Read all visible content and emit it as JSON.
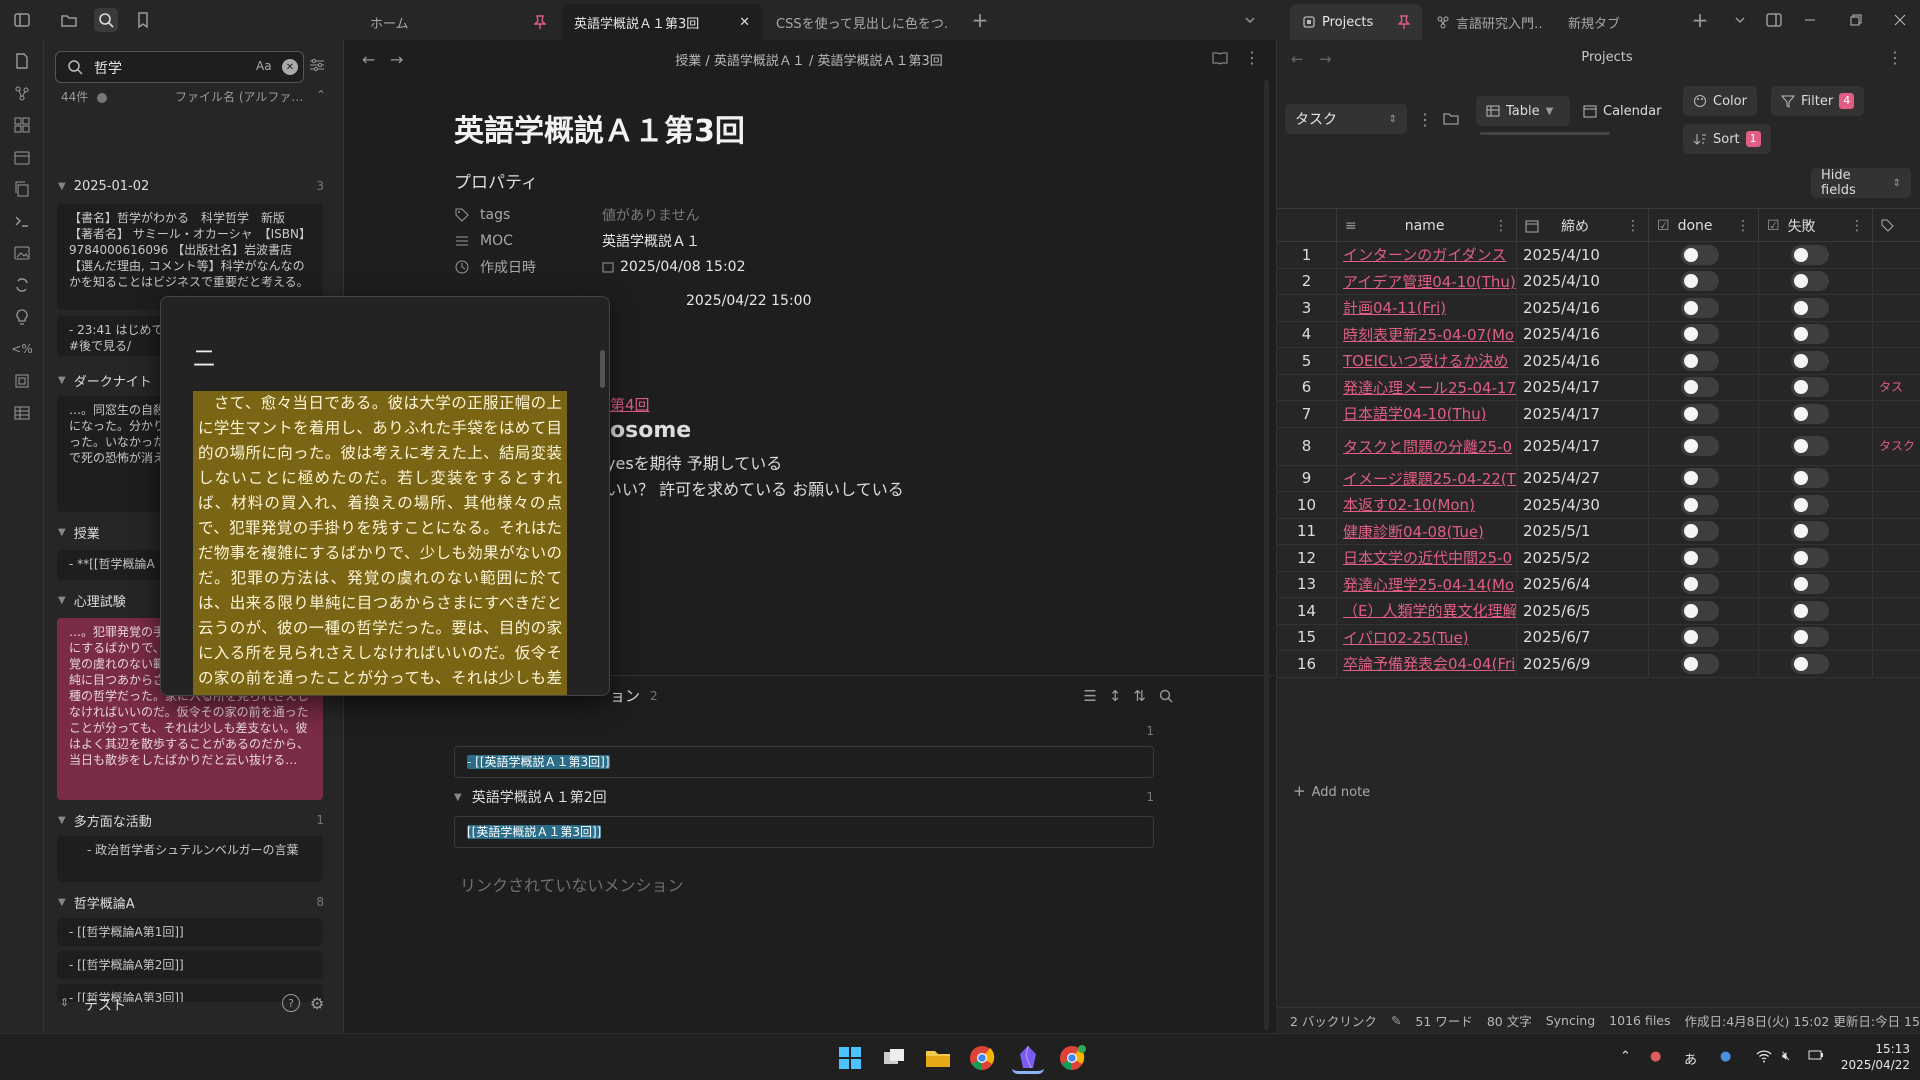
{
  "tabs": [
    {
      "label": "ホーム",
      "pinned": true
    },
    {
      "label": "英語学概説Ａ１第3回",
      "active": true
    },
    {
      "label": "CSSを使って見出しに色をつ…"
    }
  ],
  "right_tabs": [
    {
      "label": "Projects",
      "pinned": true,
      "active": true
    },
    {
      "label": "言語研究入門…"
    },
    {
      "label": "新規タブ"
    }
  ],
  "search": {
    "query": "哲学",
    "match_case": "Aa",
    "count": "44件",
    "sort": "ファイル名 (アルファ…"
  },
  "results": {
    "groups": [
      {
        "title": "2025-01-02",
        "count": "3"
      },
      {
        "title": "ダークナイト",
        "count": ""
      },
      {
        "title": "授業",
        "count": ""
      },
      {
        "title": "心理試験",
        "count": ""
      },
      {
        "title": "多方面な活動",
        "count": "1"
      },
      {
        "title": "哲学概論A",
        "count": "8"
      }
    ],
    "snippets": {
      "r1": "【書名】哲学がわかる　科学哲学　新版　【著者名】 サミール・オカーシャ　【ISBN】9784000616096 【出版社名】岩波書店【選んだ理由, コメント等】科学がなんなのかを知ることはビジネスで重要だと考える。",
      "r2": "- 23:41 はじめての政治哲学　図書館にある　#後で見る/",
      "r3": "…。同窓生の自殺がわかるように考えるようになった。分かり神に救いを求めるようになった。いなかった。ハイ論い合えという哲学で死の恐怖が消え",
      "r4": "- **[[哲学概論A",
      "r5": "…。犯罪発覚の手段をそれはただ物事を複雑にするばかりで、少しも効果がないのだ。発覚の虞れのない範囲に於ては、出来る限り単純に目つあからさまにすべきだ。が、彼の一種の哲学だった。家に入る所を見られさえしなければいいのだ。仮令その家の前を通ったことが分っても、それは少しも差支ない。彼はよく其辺を散歩することがあるのだから、当日も散歩をしたばかりだと云い抜ける…",
      "r6": "- 政治哲学者シュテルンベルガーの言葉",
      "r7": "- [[哲学概論A第1回]]",
      "r8": "- [[哲学概論A第2回]]",
      "r9": "- [[哲学概論A第3回]]"
    },
    "footer": "テスト"
  },
  "editor": {
    "breadcrumb": "授業 / 英語学概説Ａ１ / 英語学概説Ａ１第3回",
    "title": "英語学概説Ａ１第3回",
    "properties_heading": "プロパティ",
    "props": {
      "tags_key": "tags",
      "tags_val": "値がありません",
      "moc_key": "MOC",
      "moc_val": "英語学概説Ａ１",
      "created_key": "作成日時",
      "created_val": "2025/04/08  15:02",
      "updated_val": "2025/04/22  15:00"
    },
    "body": {
      "next_link": "第4回",
      "heading": "osome",
      "line1": "yesを期待 予期している",
      "line2": "いい？ 許可を求めている お願いしている"
    },
    "backlinks": {
      "heading": "ョン",
      "count": "2",
      "g1_count": "1",
      "card1": "- [[英語学概説Ａ１第3回]]",
      "group2": "英語学概説Ａ１第2回",
      "g2_count": "1",
      "card2": "[[英語学概説Ａ１第3回]]"
    },
    "unlinked": "リンクされていないメンション"
  },
  "popover": {
    "heading": "二",
    "text": "　さて、愈々当日である。彼は大学の正服正帽の上に学生マントを着用し、ありふれた手袋をはめて目的の場所に向った。彼は考えに考えた上、結局変装しないことに極めたのだ。若し変装をするとすれば、材料の買入れ、着換えの場所、其他様々の点で、犯罪発覚の手掛りを残すことになる。それはただ物事を複雑にするばかりで、少しも効果がないのだ。犯罪の方法は、発覚の虞れのない範囲に於ては、出来る限り単純に目つあからさまにすべきだと云うのが、彼の一種の哲学だった。要は、目的の家に入る所を見られさえしなければいいのだ。仮令その家の前を通ったことが分っても、それは少しも差支ない。彼はよく其辺を散歩することがあるのだか"
  },
  "projects": {
    "title": "Projects",
    "view_select": "タスク",
    "table_label": "Table",
    "calendar_label": "Calendar",
    "color_label": "Color",
    "filter_label": "Filter",
    "filter_count": "4",
    "sort_label": "Sort",
    "sort_count": "1",
    "hide_fields": "Hide fields",
    "columns": [
      "name",
      "締め",
      "done",
      "失敗"
    ],
    "rows": [
      {
        "n": "1",
        "name": "インターンのガイダンス",
        "date": "2025/4/10",
        "done": false,
        "fail": false,
        "tag": ""
      },
      {
        "n": "2",
        "name": "アイデア管理04-10(Thu)",
        "date": "2025/4/10",
        "done": false,
        "fail": false,
        "tag": ""
      },
      {
        "n": "3",
        "name": "計画04-11(Fri)",
        "date": "2025/4/16",
        "done": false,
        "fail": false,
        "tag": ""
      },
      {
        "n": "4",
        "name": "時刻表更新25-04-07(Mo",
        "date": "2025/4/16",
        "done": false,
        "fail": false,
        "tag": ""
      },
      {
        "n": "5",
        "name": "TOEICいつ受けるか決め",
        "date": "2025/4/16",
        "done": false,
        "fail": false,
        "tag": ""
      },
      {
        "n": "6",
        "name": "発達心理メール25-04-17",
        "date": "2025/4/17",
        "done": false,
        "fail": false,
        "tag": "タス"
      },
      {
        "n": "7",
        "name": "日本語学04-10(Thu)",
        "date": "2025/4/17",
        "done": false,
        "fail": false,
        "tag": ""
      },
      {
        "n": "8",
        "name": "タスクと問題の分離25-0",
        "date": "2025/4/17",
        "done": false,
        "fail": false,
        "tag": "タスク"
      },
      {
        "n": "9",
        "name": "イメージ課題25-04-22(T",
        "date": "2025/4/27",
        "done": false,
        "fail": false,
        "tag": ""
      },
      {
        "n": "10",
        "name": "本返す02-10(Mon)",
        "date": "2025/4/30",
        "done": false,
        "fail": false,
        "tag": ""
      },
      {
        "n": "11",
        "name": "健康診断04-08(Tue)",
        "date": "2025/5/1",
        "done": false,
        "fail": false,
        "tag": ""
      },
      {
        "n": "12",
        "name": "日本文学の近代中間25-0",
        "date": "2025/5/2",
        "done": false,
        "fail": false,
        "tag": ""
      },
      {
        "n": "13",
        "name": "発達心理学25-04-14(Mo",
        "date": "2025/6/4",
        "done": false,
        "fail": false,
        "tag": ""
      },
      {
        "n": "14",
        "name": "（E）人類学的異文化理解",
        "date": "2025/6/5",
        "done": false,
        "fail": false,
        "tag": ""
      },
      {
        "n": "15",
        "name": "イパロ02-25(Tue)",
        "date": "2025/6/7",
        "done": false,
        "fail": false,
        "tag": ""
      },
      {
        "n": "16",
        "name": "卒論予備発表会04-04(Fri",
        "date": "2025/6/9",
        "done": false,
        "fail": false,
        "tag": ""
      }
    ],
    "add_note": "Add note"
  },
  "status": {
    "backlinks": "2 バックリンク",
    "words": "51 ワード",
    "chars": "80 文字",
    "sync": "Syncing",
    "files": "1016 files",
    "dates": "作成日:4月8日(火) 15:02 更新日:今日 15:00"
  },
  "taskbar": {
    "ime": "あ",
    "time": "15:13",
    "date": "2025/04/22"
  },
  "colors": {
    "accent": "#e05d84",
    "highlight": "#2b6c88",
    "quote_bg": "#7a6514"
  }
}
